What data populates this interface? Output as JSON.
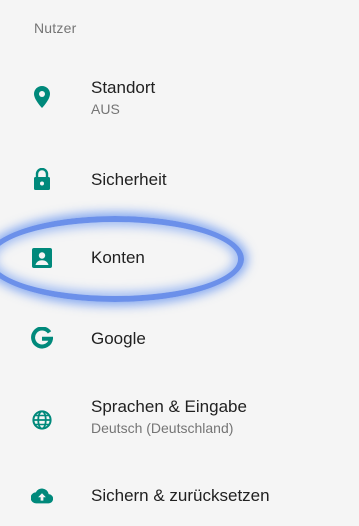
{
  "section_header": "Nutzer",
  "accent_color": "#00897b",
  "items": [
    {
      "title": "Standort",
      "subtitle": "AUS",
      "icon": "location-pin-icon"
    },
    {
      "title": "Sicherheit",
      "icon": "lock-icon"
    },
    {
      "title": "Konten",
      "icon": "account-box-icon",
      "highlighted": true
    },
    {
      "title": "Google",
      "icon": "google-g-icon"
    },
    {
      "title": "Sprachen & Eingabe",
      "subtitle": "Deutsch (Deutschland)",
      "icon": "globe-icon"
    },
    {
      "title": "Sichern & zurücksetzen",
      "icon": "cloud-upload-icon"
    }
  ]
}
